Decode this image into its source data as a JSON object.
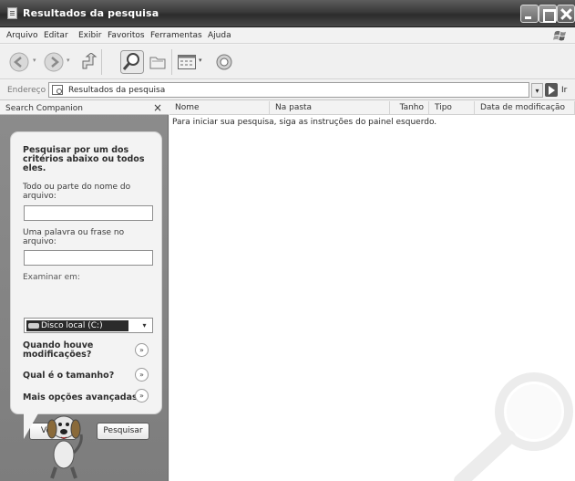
{
  "window": {
    "title": "Resultados da pesquisa"
  },
  "menu": [
    "Arquivo",
    "Editar",
    "Exibir",
    "Favoritos",
    "Ferramentas",
    "Ajuda"
  ],
  "address": {
    "label": "Endereço",
    "value": "Resultados da pesquisa",
    "go_label": "Ir"
  },
  "search_companion": {
    "title": "Search Companion",
    "heading": "Pesquisar por um dos critérios abaixo ou todos eles.",
    "filename_label": "Todo ou parte do nome do arquivo:",
    "filename_value": "",
    "phrase_label": "Uma palavra ou frase no arquivo:",
    "phrase_value": "",
    "look_in_label": "Examinar em:",
    "look_in_value": "Disco local (C:)",
    "options": [
      "Quando houve modificações?",
      "Qual é o tamanho?",
      "Mais opções avançadas"
    ],
    "back_button": "Voltar",
    "search_button": "Pesquisar"
  },
  "results": {
    "columns": [
      "Nome",
      "Na pasta",
      "Tanho",
      "Tipo",
      "Data de modificação"
    ],
    "hint": "Para iniciar sua pesquisa, siga as instruções do painel esquerdo."
  }
}
